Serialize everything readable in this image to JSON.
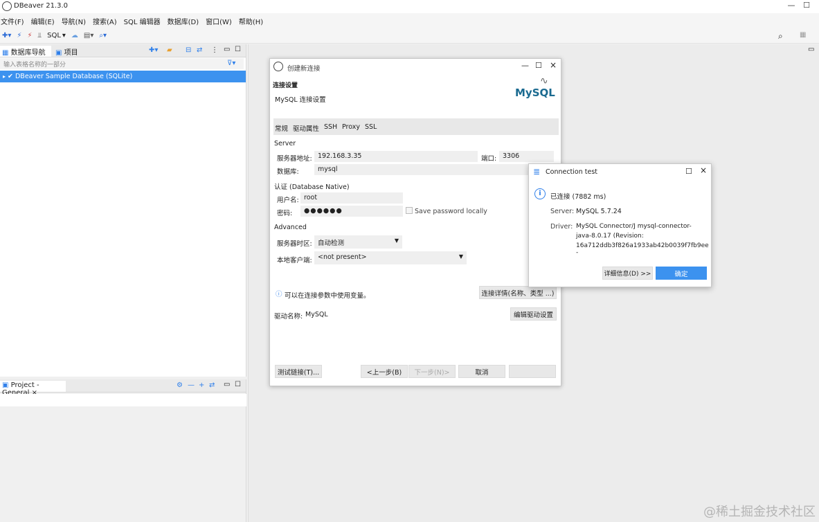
{
  "app": {
    "title": "DBeaver 21.3.0",
    "menu": [
      "文件(F)",
      "编辑(E)",
      "导航(N)",
      "搜索(A)",
      "SQL 编辑器",
      "数据库(D)",
      "窗口(W)",
      "帮助(H)"
    ],
    "toolbar_sql": "SQL"
  },
  "navigator": {
    "tab_db": "数据库导航",
    "tab_project": "项目",
    "filter_placeholder": "输入表格名称的一部分",
    "tree_item": "DBeaver Sample Database (SQLite)"
  },
  "project_panel": {
    "tab": "Project - General"
  },
  "dialog": {
    "title": "创建新连接",
    "heading": "连接设置",
    "subheading": "MySQL 连接设置",
    "logo": "MySQL",
    "tabs": [
      "常规",
      "驱动属性",
      "SSH",
      "Proxy",
      "SSL"
    ],
    "server_section": "Server",
    "host_label": "服务器地址:",
    "host_value": "192.168.3.35",
    "port_label": "端口:",
    "port_value": "3306",
    "db_label": "数据库:",
    "db_value": "mysql",
    "auth_section": "认证 (Database Native)",
    "user_label": "用户名:",
    "user_value": "root",
    "pass_label": "密码:",
    "pass_value": "●●●●●●",
    "save_password": "Save password locally",
    "advanced_section": "Advanced",
    "timezone_label": "服务器时区:",
    "timezone_value": "自动检测",
    "client_label": "本地客户端:",
    "client_value": "<not present>",
    "info_text": "可以在连接参数中使用变量。",
    "conn_details_btn": "连接详情(名称、类型 ...)",
    "driver_label": "驱动名称:",
    "driver_value": "MySQL",
    "edit_driver_btn": "编辑驱动设置",
    "test_btn": "测试链接(T)...",
    "back_btn": "<上一步(B)",
    "next_btn": "下一步(N)>",
    "cancel_btn": "取消",
    "finish_btn": ""
  },
  "conn_test": {
    "title": "Connection test",
    "status": "已连接 (7882 ms)",
    "server_label": "Server:",
    "server_value": "MySQL 5.7.24",
    "driver_label": "Driver:",
    "driver_line1": "MySQL Connector/J mysql-connector-",
    "driver_line2": "java-8.0.17 (Revision:",
    "driver_line3": "16a712ddb3f826a1933ab42b0039f7fb9ee -",
    "details_btn": "详细信息(D) >>",
    "ok_btn": "确定"
  },
  "watermark": "@稀土掘金技术社区",
  "colors": {
    "accent": "#2e7fea",
    "selection": "#3c92ef"
  }
}
